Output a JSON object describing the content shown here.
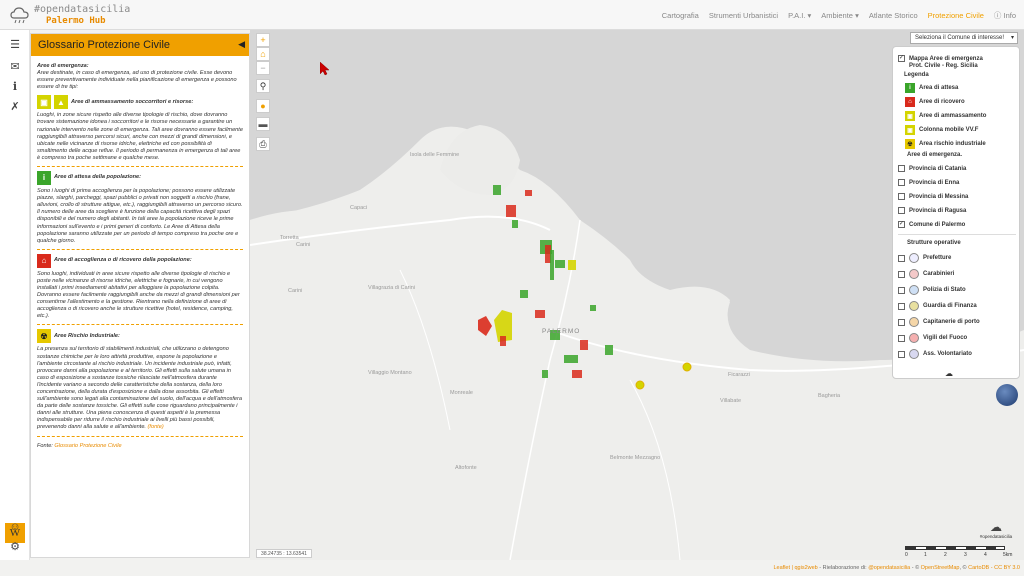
{
  "header": {
    "logo_line1": "#opendatasicilia",
    "logo_line2": "Palermo Hub",
    "nav": [
      {
        "label": "Cartografia",
        "active": false
      },
      {
        "label": "Strumenti Urbanistici",
        "active": false
      },
      {
        "label": "P.A.I. ▾",
        "active": false
      },
      {
        "label": "Ambiente ▾",
        "active": false
      },
      {
        "label": "Atlante Storico",
        "active": false
      },
      {
        "label": "Protezione Civile",
        "active": true
      },
      {
        "label": "ⓘ Info",
        "active": false
      }
    ]
  },
  "sidebar": {
    "icons": [
      "menu-icon",
      "mail-icon",
      "info-icon",
      "share-icon"
    ],
    "wiki_label": "W"
  },
  "panel": {
    "title": "Glossario Protezione Civile",
    "collapse_glyph": "◀",
    "intro_heading": "Aree di emergenza:",
    "intro_text": "Aree destinate, in caso di emergenza, ad uso di protezione civile. Esse devono essere preventivamente individuate nella pianificazione di emergenza e possono essere di tre tipi:",
    "sections": [
      {
        "heading": "Aree di ammassamento soccorritori e risorse:",
        "text": "Luoghi, in zone sicure rispetto alle diverse tipologie di rischio, dove dovranno trovare sistemazione idonea i soccorritori e le risorse necessarie a garantire un razionale intervento nelle zone di emergenza. Tali aree dovranno essere facilmente raggiungibili attraverso percorsi sicuri, anche con mezzi di grandi dimensioni, e ubicate nelle vicinanze di risorse idriche, elettriche ed con possibilità di smaltimento delle acque reflue. Il periodo di permanenza in emergenza di tali aree è compreso tra poche settimane e qualche mese."
      },
      {
        "heading": "Aree di attesa della popolazione:",
        "text": "Sono i luoghi di prima accoglienza per la popolazione; possono essere utilizzate piazze, slarghi, parcheggi, spazi pubblici o privati non soggetti a rischio (frane, alluvioni, crollo di strutture attigue, etc.), raggiungibili attraverso un percorso sicuro. Il numero delle aree da scegliere è funzione della capacità ricettiva degli spazi disponibili e del numero degli abitanti. In tali aree la popolazione riceve le prime informazioni sull'evento e i primi generi di conforto. Le Aree di Attesa della popolazione saranno utilizzate per un periodo di tempo compreso tra poche ore e qualche giorno."
      },
      {
        "heading": "Aree di accoglienza o di ricovero della popolazione:",
        "text": "Sono luoghi, individuati in aree sicure rispetto alle diverse tipologie di rischio e poste nelle vicinanze di risorse idriche, elettriche e fognarie, in cui vengono installati i primi insediamenti abitativi per alloggiare la popolazione colpita. Dovranno essere facilmente raggiungibili anche da mezzi di grandi dimensioni per consentirne l'allestimento e la gestione. Rientrano nella definizione di aree di accoglienza o di ricovero anche le strutture ricettive (hotel, residence, camping, etc.)."
      },
      {
        "heading": "Aree Rischio Industriale:",
        "text": "La presenza sul territorio di stabilimenti industriali, che utilizzano o detengono sostanze chimiche per le loro attività produttive, espone la popolazione e l'ambiente circostante al rischio industriale. Un incidente industriale può, infatti, provocare danni alla popolazione e al territorio. Gli effetti sulla salute umana in caso di esposizione a sostanze tossiche rilasciate nell'atmosfera durante l'incidente variano a secondo delle caratteristiche della sostanza, della loro concentrazione, della durata d'esposizione e dalla dose assorbita. Gli effetti sull'ambiente sono legati alla contaminazione del suolo, dell'acqua e dell'atmosfera da parte delle sostanze tossiche. Gli effetti sulle cose riguardano principalmente i danni alle strutture. Una piena conoscenza di questi aspetti è la premessa indispensabile per ridurre il rischio industriale ai livelli più bassi possibili, prevenendo danni alla salute e all'ambiente."
      }
    ],
    "fonte_inline": "(fonte)",
    "source_prefix": "Fonte:",
    "source_link": "Glossario Protezione Civile"
  },
  "map": {
    "select_value": "Seleziona il Comune di interesse!",
    "coordinates": "38.24735 : 13.63541",
    "labels": [
      "Isola delle Femmine",
      "Capaci",
      "Torretta",
      "Carini",
      "Villagrazia di Carini",
      "Carini",
      "Villaggio Montano",
      "Monreale",
      "Altofonte",
      "Belmonte Mezzagno",
      "Villabate",
      "Ficarazzi",
      "Bagheria",
      "PALERMO"
    ]
  },
  "layers": {
    "main_title": "Mappa Aree di emergenza",
    "main_subtitle": "Prot. Civile - Reg. Sicilia",
    "legend_label": "Legenda",
    "legend": [
      {
        "label": "Area di attesa",
        "color": "#3aa52a",
        "icon": "i"
      },
      {
        "label": "Aree di ricovero",
        "color": "#d92a1c",
        "icon": "⌂"
      },
      {
        "label": "Aree di ammassamento",
        "color": "#d4d400",
        "icon": "▣"
      },
      {
        "label": "Colonna mobile VV.F",
        "color": "#d4d400",
        "icon": "▣"
      },
      {
        "label": "Area rischio industriale",
        "color": "#e6c800",
        "icon": "☢"
      }
    ],
    "provinces_heading": "Aree di emergenza.",
    "provinces": [
      {
        "label": "Provincia di Catania",
        "checked": false
      },
      {
        "label": "Provincia di Enna",
        "checked": false
      },
      {
        "label": "Provincia di Messina",
        "checked": false
      },
      {
        "label": "Provincia di Ragusa",
        "checked": false
      },
      {
        "label": "Comune di Palermo",
        "checked": true
      }
    ],
    "structures_heading": "Strutture operative",
    "structures": [
      {
        "label": "Prefetture",
        "icon": "prefecture-icon"
      },
      {
        "label": "Carabinieri",
        "icon": "carabinieri-icon"
      },
      {
        "label": "Polizia di Stato",
        "icon": "police-icon"
      },
      {
        "label": "Guardia di Finanza",
        "icon": "finance-guard-icon"
      },
      {
        "label": "Capitanerie di porto",
        "icon": "coast-guard-icon"
      },
      {
        "label": "Vigili del Fuoco",
        "icon": "firefighters-icon"
      },
      {
        "label": "Ass. Volontariato",
        "icon": "volunteers-icon"
      }
    ]
  },
  "footer": {
    "attribution_a": "Leaflet | ",
    "attribution_b": "qgis2web",
    "attribution_c": " - Rielaborazione di: ",
    "attribution_d": "@opendatasicilia",
    "attribution_e": " - © ",
    "attribution_f": "OpenStreetMap",
    "attribution_g": ", © ",
    "attribution_h": "CartoDB",
    "attribution_i": " - CC BY 3.0",
    "scale_labels": [
      "0",
      "1",
      "2",
      "3",
      "4",
      "5km"
    ],
    "brand_text": "#opendatasicilia"
  },
  "colors": {
    "accent": "#f0a000",
    "attesa": "#3aa52a",
    "ricovero": "#d92a1c",
    "ammassamento": "#d4d400"
  }
}
